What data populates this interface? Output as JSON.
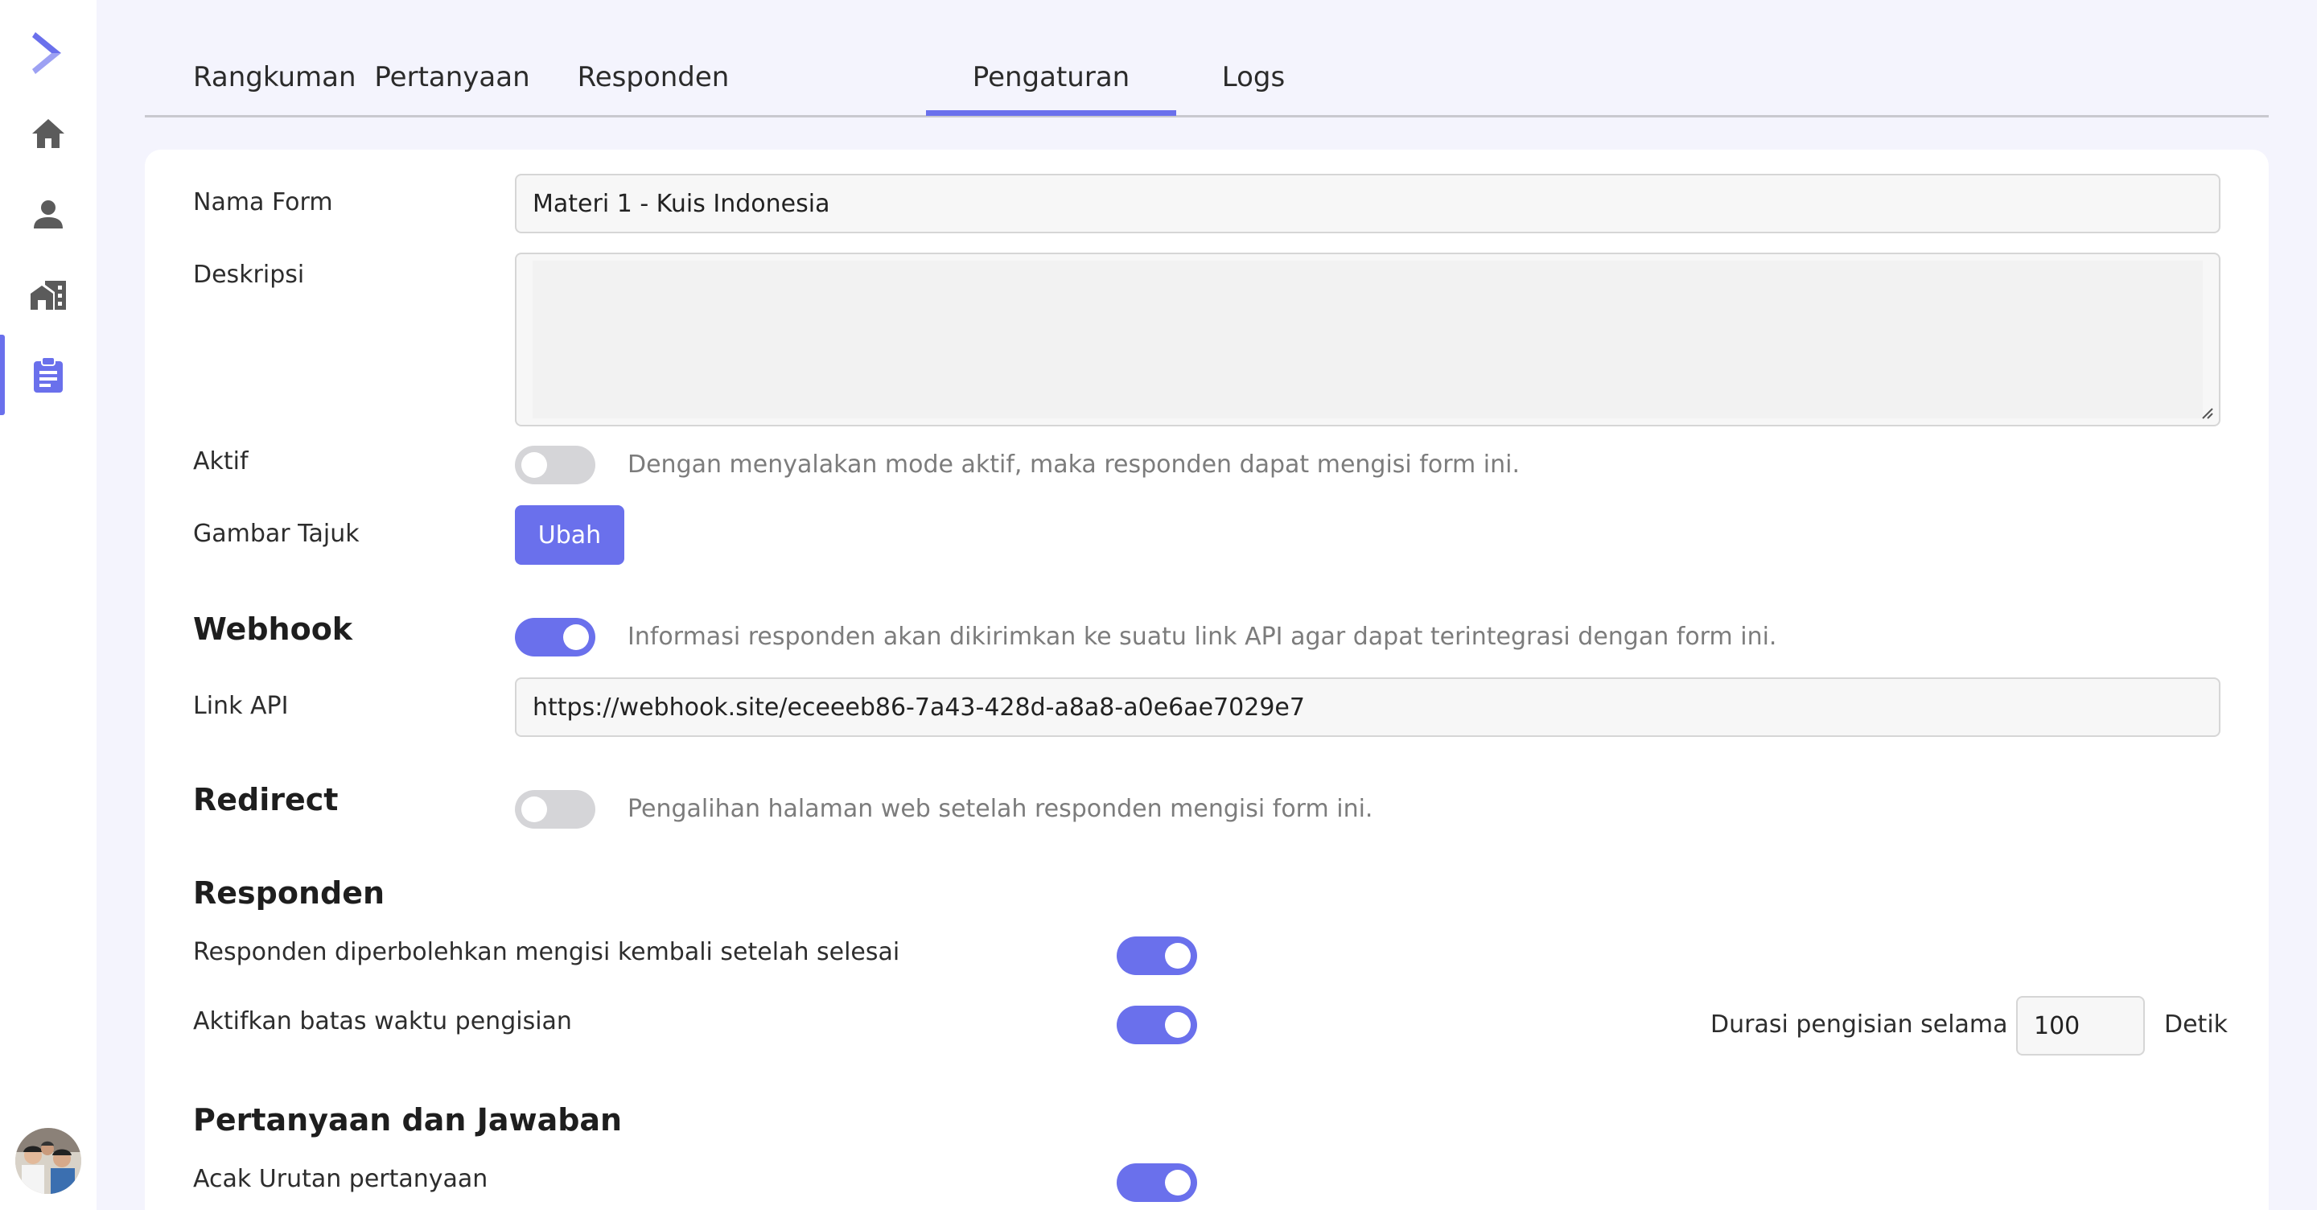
{
  "colors": {
    "accent": "#6a70ec",
    "page_bg": "#f4f4fd",
    "toggle_off": "#d5d5d8"
  },
  "sidebar": {
    "items": [
      {
        "icon": "logo-chevron-icon"
      },
      {
        "icon": "home-icon"
      },
      {
        "icon": "person-icon"
      },
      {
        "icon": "building-icon"
      },
      {
        "icon": "clipboard-icon",
        "active": true
      }
    ],
    "avatar": "avatar"
  },
  "tabs": [
    {
      "label": "Rangkuman"
    },
    {
      "label": "Pertanyaan"
    },
    {
      "label": "Responden"
    },
    {
      "label": "Pengaturan",
      "active": true
    },
    {
      "label": "Logs"
    }
  ],
  "form": {
    "name_label": "Nama Form",
    "name_value": "Materi 1 - Kuis Indonesia",
    "description_label": "Deskripsi",
    "description_value": "",
    "active_label": "Aktif",
    "active_on": false,
    "active_hint": "Dengan menyalakan mode aktif, maka responden dapat mengisi form ini.",
    "header_image_label": "Gambar Tajuk",
    "change_button": "Ubah"
  },
  "webhook": {
    "heading": "Webhook",
    "enabled": true,
    "hint": "Informasi responden akan dikirimkan ke suatu link API agar dapat terintegrasi dengan form ini.",
    "link_label": "Link API",
    "link_value": "https://webhook.site/eceeeb86-7a43-428d-a8a8-a0e6ae7029e7"
  },
  "redirect": {
    "heading": "Redirect",
    "enabled": false,
    "hint": "Pengalihan halaman web setelah responden mengisi form ini."
  },
  "responden": {
    "heading": "Responden",
    "allow_refill_label": "Responden diperbolehkan mengisi kembali setelah selesai",
    "allow_refill_on": true,
    "time_limit_label": "Aktifkan batas waktu pengisian",
    "time_limit_on": true,
    "duration_label": "Durasi pengisian selama",
    "duration_value": "100",
    "duration_unit": "Detik"
  },
  "qa": {
    "heading": "Pertanyaan dan Jawaban",
    "shuffle_label": "Acak Urutan pertanyaan",
    "shuffle_on": true
  }
}
